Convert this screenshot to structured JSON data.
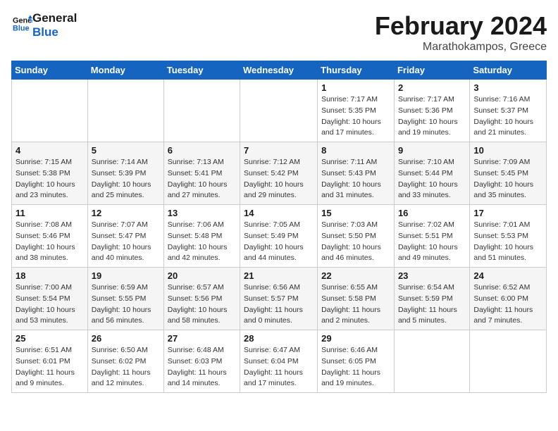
{
  "header": {
    "logo_line1": "General",
    "logo_line2": "Blue",
    "month": "February 2024",
    "location": "Marathokampos, Greece"
  },
  "days_of_week": [
    "Sunday",
    "Monday",
    "Tuesday",
    "Wednesday",
    "Thursday",
    "Friday",
    "Saturday"
  ],
  "weeks": [
    [
      {
        "day": "",
        "info": ""
      },
      {
        "day": "",
        "info": ""
      },
      {
        "day": "",
        "info": ""
      },
      {
        "day": "",
        "info": ""
      },
      {
        "day": "1",
        "info": "Sunrise: 7:17 AM\nSunset: 5:35 PM\nDaylight: 10 hours\nand 17 minutes."
      },
      {
        "day": "2",
        "info": "Sunrise: 7:17 AM\nSunset: 5:36 PM\nDaylight: 10 hours\nand 19 minutes."
      },
      {
        "day": "3",
        "info": "Sunrise: 7:16 AM\nSunset: 5:37 PM\nDaylight: 10 hours\nand 21 minutes."
      }
    ],
    [
      {
        "day": "4",
        "info": "Sunrise: 7:15 AM\nSunset: 5:38 PM\nDaylight: 10 hours\nand 23 minutes."
      },
      {
        "day": "5",
        "info": "Sunrise: 7:14 AM\nSunset: 5:39 PM\nDaylight: 10 hours\nand 25 minutes."
      },
      {
        "day": "6",
        "info": "Sunrise: 7:13 AM\nSunset: 5:41 PM\nDaylight: 10 hours\nand 27 minutes."
      },
      {
        "day": "7",
        "info": "Sunrise: 7:12 AM\nSunset: 5:42 PM\nDaylight: 10 hours\nand 29 minutes."
      },
      {
        "day": "8",
        "info": "Sunrise: 7:11 AM\nSunset: 5:43 PM\nDaylight: 10 hours\nand 31 minutes."
      },
      {
        "day": "9",
        "info": "Sunrise: 7:10 AM\nSunset: 5:44 PM\nDaylight: 10 hours\nand 33 minutes."
      },
      {
        "day": "10",
        "info": "Sunrise: 7:09 AM\nSunset: 5:45 PM\nDaylight: 10 hours\nand 35 minutes."
      }
    ],
    [
      {
        "day": "11",
        "info": "Sunrise: 7:08 AM\nSunset: 5:46 PM\nDaylight: 10 hours\nand 38 minutes."
      },
      {
        "day": "12",
        "info": "Sunrise: 7:07 AM\nSunset: 5:47 PM\nDaylight: 10 hours\nand 40 minutes."
      },
      {
        "day": "13",
        "info": "Sunrise: 7:06 AM\nSunset: 5:48 PM\nDaylight: 10 hours\nand 42 minutes."
      },
      {
        "day": "14",
        "info": "Sunrise: 7:05 AM\nSunset: 5:49 PM\nDaylight: 10 hours\nand 44 minutes."
      },
      {
        "day": "15",
        "info": "Sunrise: 7:03 AM\nSunset: 5:50 PM\nDaylight: 10 hours\nand 46 minutes."
      },
      {
        "day": "16",
        "info": "Sunrise: 7:02 AM\nSunset: 5:51 PM\nDaylight: 10 hours\nand 49 minutes."
      },
      {
        "day": "17",
        "info": "Sunrise: 7:01 AM\nSunset: 5:53 PM\nDaylight: 10 hours\nand 51 minutes."
      }
    ],
    [
      {
        "day": "18",
        "info": "Sunrise: 7:00 AM\nSunset: 5:54 PM\nDaylight: 10 hours\nand 53 minutes."
      },
      {
        "day": "19",
        "info": "Sunrise: 6:59 AM\nSunset: 5:55 PM\nDaylight: 10 hours\nand 56 minutes."
      },
      {
        "day": "20",
        "info": "Sunrise: 6:57 AM\nSunset: 5:56 PM\nDaylight: 10 hours\nand 58 minutes."
      },
      {
        "day": "21",
        "info": "Sunrise: 6:56 AM\nSunset: 5:57 PM\nDaylight: 11 hours\nand 0 minutes."
      },
      {
        "day": "22",
        "info": "Sunrise: 6:55 AM\nSunset: 5:58 PM\nDaylight: 11 hours\nand 2 minutes."
      },
      {
        "day": "23",
        "info": "Sunrise: 6:54 AM\nSunset: 5:59 PM\nDaylight: 11 hours\nand 5 minutes."
      },
      {
        "day": "24",
        "info": "Sunrise: 6:52 AM\nSunset: 6:00 PM\nDaylight: 11 hours\nand 7 minutes."
      }
    ],
    [
      {
        "day": "25",
        "info": "Sunrise: 6:51 AM\nSunset: 6:01 PM\nDaylight: 11 hours\nand 9 minutes."
      },
      {
        "day": "26",
        "info": "Sunrise: 6:50 AM\nSunset: 6:02 PM\nDaylight: 11 hours\nand 12 minutes."
      },
      {
        "day": "27",
        "info": "Sunrise: 6:48 AM\nSunset: 6:03 PM\nDaylight: 11 hours\nand 14 minutes."
      },
      {
        "day": "28",
        "info": "Sunrise: 6:47 AM\nSunset: 6:04 PM\nDaylight: 11 hours\nand 17 minutes."
      },
      {
        "day": "29",
        "info": "Sunrise: 6:46 AM\nSunset: 6:05 PM\nDaylight: 11 hours\nand 19 minutes."
      },
      {
        "day": "",
        "info": ""
      },
      {
        "day": "",
        "info": ""
      }
    ]
  ]
}
